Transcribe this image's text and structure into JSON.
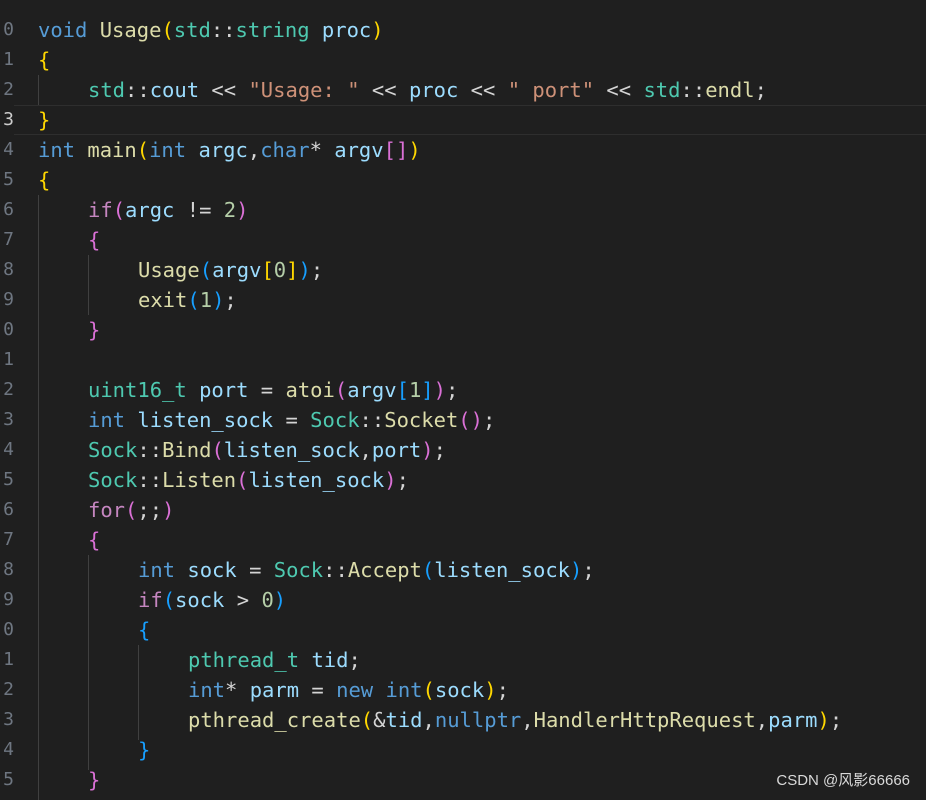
{
  "line_numbers": [
    "0",
    "1",
    "2",
    "3",
    "4",
    "5",
    "6",
    "7",
    "8",
    "9",
    "0",
    "1",
    "2",
    "3",
    "4",
    "5",
    "6",
    "7",
    "8",
    "9",
    "0",
    "1",
    "2",
    "3",
    "4",
    "5"
  ],
  "code": [
    {
      "l": [
        "void",
        " ",
        "Usage",
        "(",
        "std",
        "::",
        "string",
        " ",
        "proc",
        ")"
      ]
    },
    {
      "l": [
        "{"
      ]
    },
    {
      "l": [
        "std",
        "::",
        "cout",
        " << ",
        "\"Usage: \"",
        " << ",
        "proc",
        " << ",
        "\" port\"",
        " << ",
        "std",
        "::",
        "endl",
        ";"
      ]
    },
    {
      "l": [
        "}"
      ]
    },
    {
      "l": [
        "int",
        " ",
        "main",
        "(",
        "int",
        " ",
        "argc",
        ",",
        "char",
        "* ",
        "argv",
        "[]",
        ")"
      ]
    },
    {
      "l": [
        "{"
      ]
    },
    {
      "l": [
        "if",
        "(",
        "argc",
        " != ",
        "2",
        ")"
      ]
    },
    {
      "l": [
        "{"
      ]
    },
    {
      "l": [
        "Usage",
        "(",
        "argv",
        "[",
        "0",
        "]",
        ")",
        ";"
      ]
    },
    {
      "l": [
        "exit",
        "(",
        "1",
        ")",
        ";"
      ]
    },
    {
      "l": [
        "}"
      ]
    },
    {
      "l": []
    },
    {
      "l": [
        "uint16_t",
        " ",
        "port",
        " = ",
        "atoi",
        "(",
        "argv",
        "[",
        "1",
        "]",
        ")",
        ";"
      ]
    },
    {
      "l": [
        "int",
        " ",
        "listen_sock",
        " = ",
        "Sock",
        "::",
        "Socket",
        "()",
        ";"
      ]
    },
    {
      "l": [
        "Sock",
        "::",
        "Bind",
        "(",
        "listen_sock",
        ",",
        "port",
        ")",
        ";"
      ]
    },
    {
      "l": [
        "Sock",
        "::",
        "Listen",
        "(",
        "listen_sock",
        ")",
        ";"
      ]
    },
    {
      "l": [
        "for",
        "(",
        ";;",
        ")"
      ]
    },
    {
      "l": [
        "{"
      ]
    },
    {
      "l": [
        "int",
        " ",
        "sock",
        " = ",
        "Sock",
        "::",
        "Accept",
        "(",
        "listen_sock",
        ")",
        ";"
      ]
    },
    {
      "l": [
        "if",
        "(",
        "sock",
        " > ",
        "0",
        ")"
      ]
    },
    {
      "l": [
        "{"
      ]
    },
    {
      "l": [
        "pthread_t",
        " ",
        "tid",
        ";"
      ]
    },
    {
      "l": [
        "int",
        "* ",
        "parm",
        " = ",
        "new",
        " ",
        "int",
        "(",
        "sock",
        ")",
        ";"
      ]
    },
    {
      "l": [
        "pthread_create",
        "(",
        "&",
        "tid",
        ",",
        "nullptr",
        ",",
        "HandlerHttpRequest",
        ",",
        "parm",
        ")",
        ";"
      ]
    },
    {
      "l": [
        "}"
      ]
    },
    {
      "l": [
        "}"
      ]
    }
  ],
  "watermark": "CSDN @风影66666",
  "colors": {
    "background": "#1f1f1f",
    "keyword": "#569cd6",
    "function": "#dcdcaa",
    "type": "#4ec9b0",
    "variable": "#9cdcfe",
    "string": "#ce9178",
    "number": "#b5cea8",
    "control": "#c586c0",
    "bracket_gold": "#ffd700",
    "bracket_orchid": "#da70d6",
    "bracket_blue": "#179fff"
  }
}
